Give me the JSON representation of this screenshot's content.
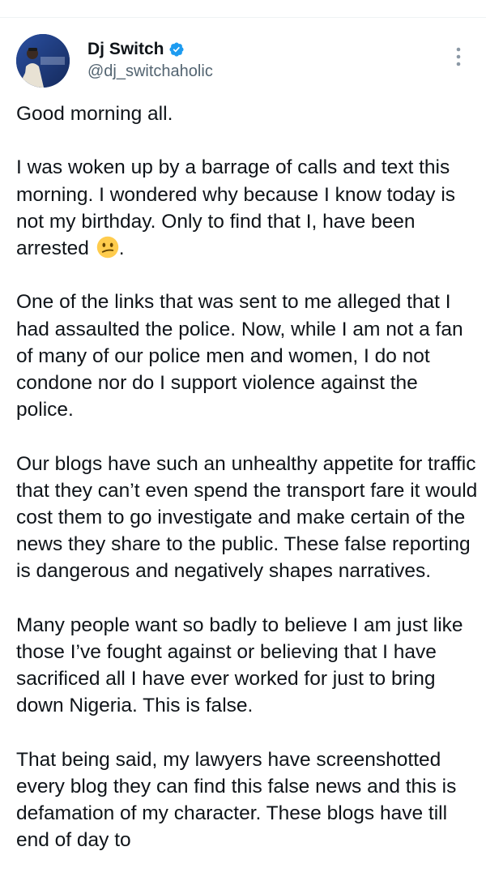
{
  "tweet": {
    "author": {
      "display_name": "Dj Switch",
      "handle": "@dj_switchaholic",
      "verified": true,
      "avatar_icon": "profile-photo"
    },
    "more_icon": "more-vertical-icon",
    "verified_color": "#1d9bf0",
    "paragraphs": {
      "p1": "Good morning all.",
      "p2_text": "I was woken up by a barrage of calls and text this morning. I wondered why because I know today is not my birthday. Only to find that I, have been arrested",
      "p2_emoji": "confused-face-emoji",
      "p2_end": ".",
      "p3": "One of the links that was sent to me alleged that I had assaulted the police. Now, while I am not a fan of many of our police men and women, I do not condone nor do I support violence against the police.",
      "p4": "Our blogs have such an unhealthy appetite for traffic that they can’t even spend the transport fare it would cost them to go investigate and make certain of the news they share to the public. These false reporting is dangerous and negatively shapes narratives.",
      "p5": "Many people want so badly to believe I am just like those I’ve fought against or believing that I have sacrificed all I have ever worked for just to bring down Nigeria. This is false.",
      "p6": "That being said, my lawyers have screenshotted every blog they can find this false news and this is defamation of my character. These blogs have till end of day to"
    }
  }
}
